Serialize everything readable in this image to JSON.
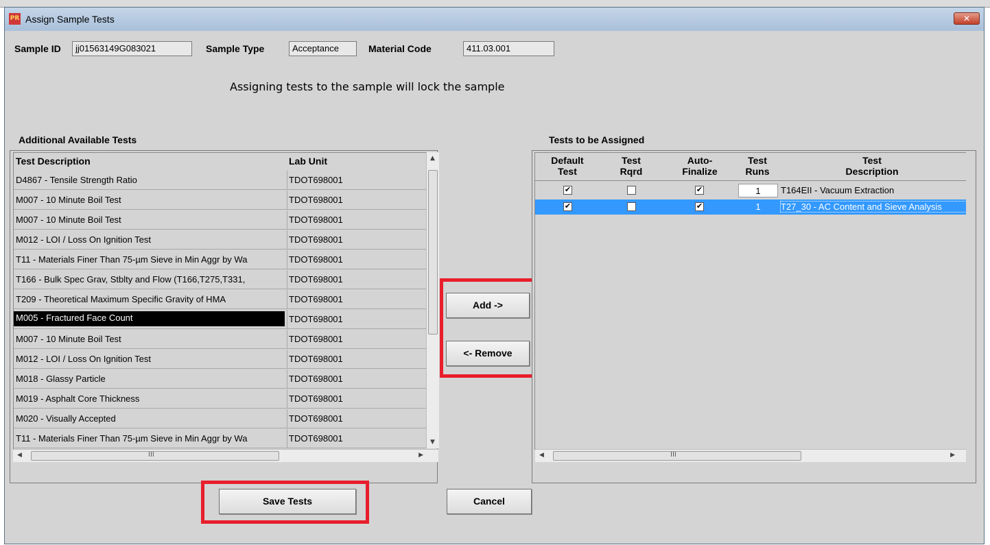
{
  "window": {
    "title": "Assign Sample Tests",
    "app_icon": "prism-app-icon",
    "close_icon": "close-x-icon"
  },
  "header": {
    "sample_id_label": "Sample ID",
    "sample_id_value": "jj01563149G083021",
    "sample_type_label": "Sample Type",
    "sample_type_value": "Acceptance",
    "material_code_label": "Material Code",
    "material_code_value": "411.03.001"
  },
  "notice": "Assigning tests to the sample will lock the sample",
  "available": {
    "label": "Additional Available Tests",
    "columns": [
      "Test Description",
      "Lab Unit"
    ],
    "rows": [
      {
        "desc": "D4867 - Tensile Strength Ratio",
        "unit": "TDOT698001"
      },
      {
        "desc": "M007 - 10 Minute Boil Test",
        "unit": "TDOT698001"
      },
      {
        "desc": "M007 - 10 Minute Boil Test",
        "unit": "TDOT698001"
      },
      {
        "desc": "M012 - LOI / Loss On Ignition Test",
        "unit": "TDOT698001"
      },
      {
        "desc": "T11 - Materials Finer Than 75-µm Sieve in Min Aggr by Wa",
        "unit": "TDOT698001"
      },
      {
        "desc": "T166 - Bulk Spec Grav, Stblty and Flow (T166,T275,T331,",
        "unit": "TDOT698001"
      },
      {
        "desc": "T209 - Theoretical Maximum Specific Gravity of HMA",
        "unit": "TDOT698001"
      },
      {
        "desc": "M005 - Fractured Face Count",
        "unit": "TDOT698001"
      },
      {
        "desc": "M007 - 10 Minute Boil Test",
        "unit": "TDOT698001"
      },
      {
        "desc": "M012 - LOI / Loss On Ignition Test",
        "unit": "TDOT698001"
      },
      {
        "desc": "M018 - Glassy Particle",
        "unit": "TDOT698001"
      },
      {
        "desc": "M019 - Asphalt Core Thickness",
        "unit": "TDOT698001"
      },
      {
        "desc": "M020 - Visually Accepted",
        "unit": "TDOT698001"
      },
      {
        "desc": "T11 - Materials Finer Than 75-µm Sieve in Min Aggr by Wa",
        "unit": "TDOT698001"
      }
    ],
    "selected_index": 7,
    "hscroll_grip": "III"
  },
  "buttons": {
    "add": "Add ->",
    "remove": "<- Remove",
    "save": "Save Tests",
    "cancel": "Cancel"
  },
  "assigned": {
    "label": "Tests to be Assigned",
    "columns": [
      {
        "line1": "Default",
        "line2": "Test"
      },
      {
        "line1": "Test",
        "line2": "Rqrd"
      },
      {
        "line1": "Auto-",
        "line2": "Finalize"
      },
      {
        "line1": "Test",
        "line2": "Runs"
      },
      {
        "line1": "Test",
        "line2": "Description"
      }
    ],
    "rows": [
      {
        "default_test": true,
        "test_rqrd": false,
        "auto_finalize": true,
        "runs": "1",
        "desc": "T164EII - Vacuum Extraction"
      },
      {
        "default_test": true,
        "test_rqrd": false,
        "auto_finalize": true,
        "runs": "1",
        "desc": "T27_30 - AC Content and Sieve Analysis"
      }
    ],
    "selected_index": 1,
    "hscroll_grip": "III"
  },
  "colors": {
    "highlight_red": "#e81e2c",
    "selection_blue": "#3399ff",
    "panel_gray": "#d4d4d4"
  }
}
